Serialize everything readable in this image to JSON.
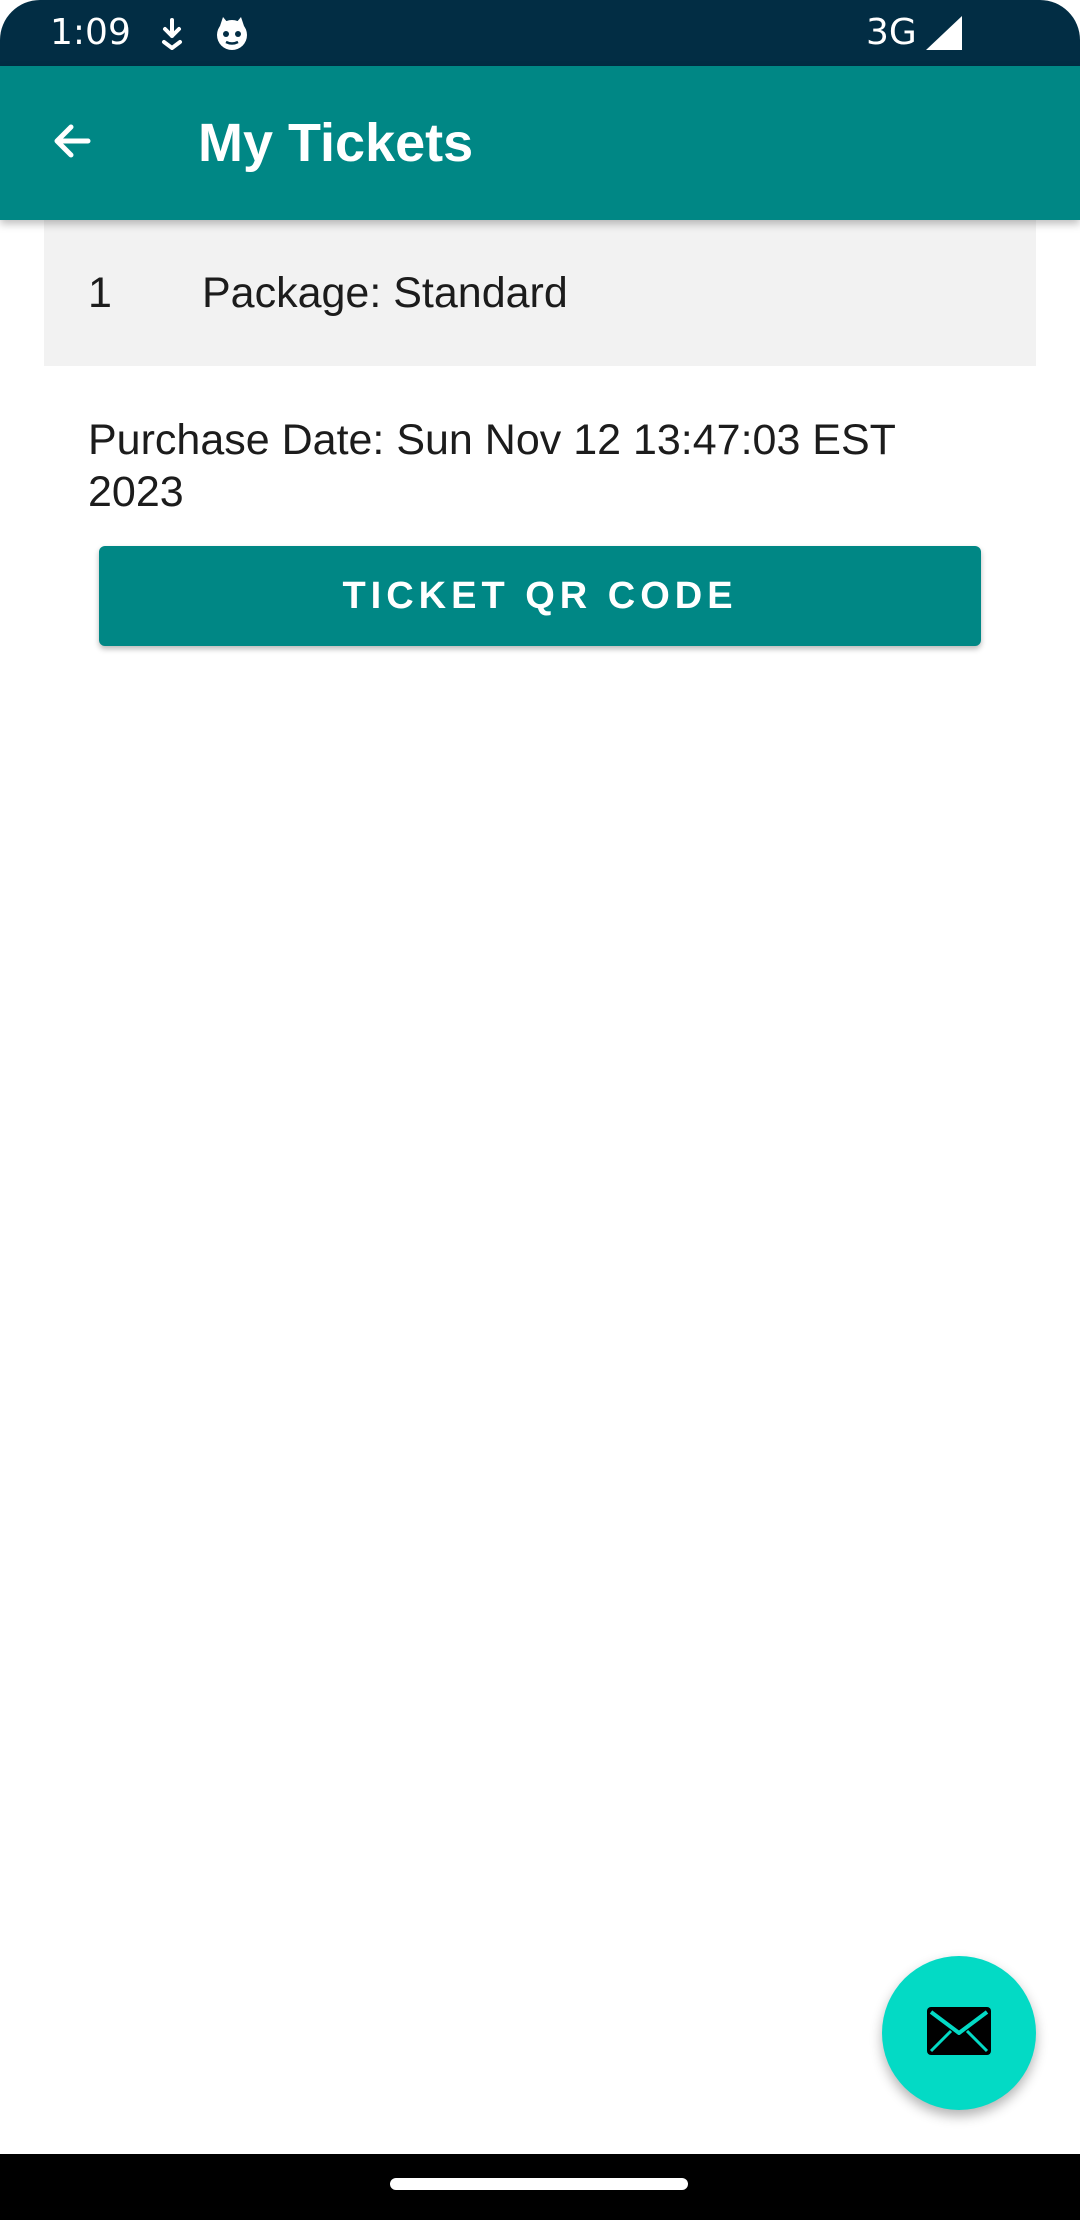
{
  "status_bar": {
    "time": "1:09",
    "network": "3G",
    "icons": [
      "download-icon",
      "cat-face-icon",
      "signal-icon"
    ]
  },
  "app_bar": {
    "title": "My Tickets",
    "back_icon": "arrow-back-icon"
  },
  "ticket": {
    "index": "1",
    "package": "Package: Standard",
    "purchase_date": "Purchase Date: Sun Nov 12 13:47:03 EST 2023",
    "qr_button_label": "TICKET QR CODE"
  },
  "fab": {
    "icon": "mail-icon"
  },
  "colors": {
    "status_bar": "#022d44",
    "app_bar": "#008785",
    "button": "#008785",
    "fab": "#03dac5",
    "row_background": "#f2f2f2"
  }
}
